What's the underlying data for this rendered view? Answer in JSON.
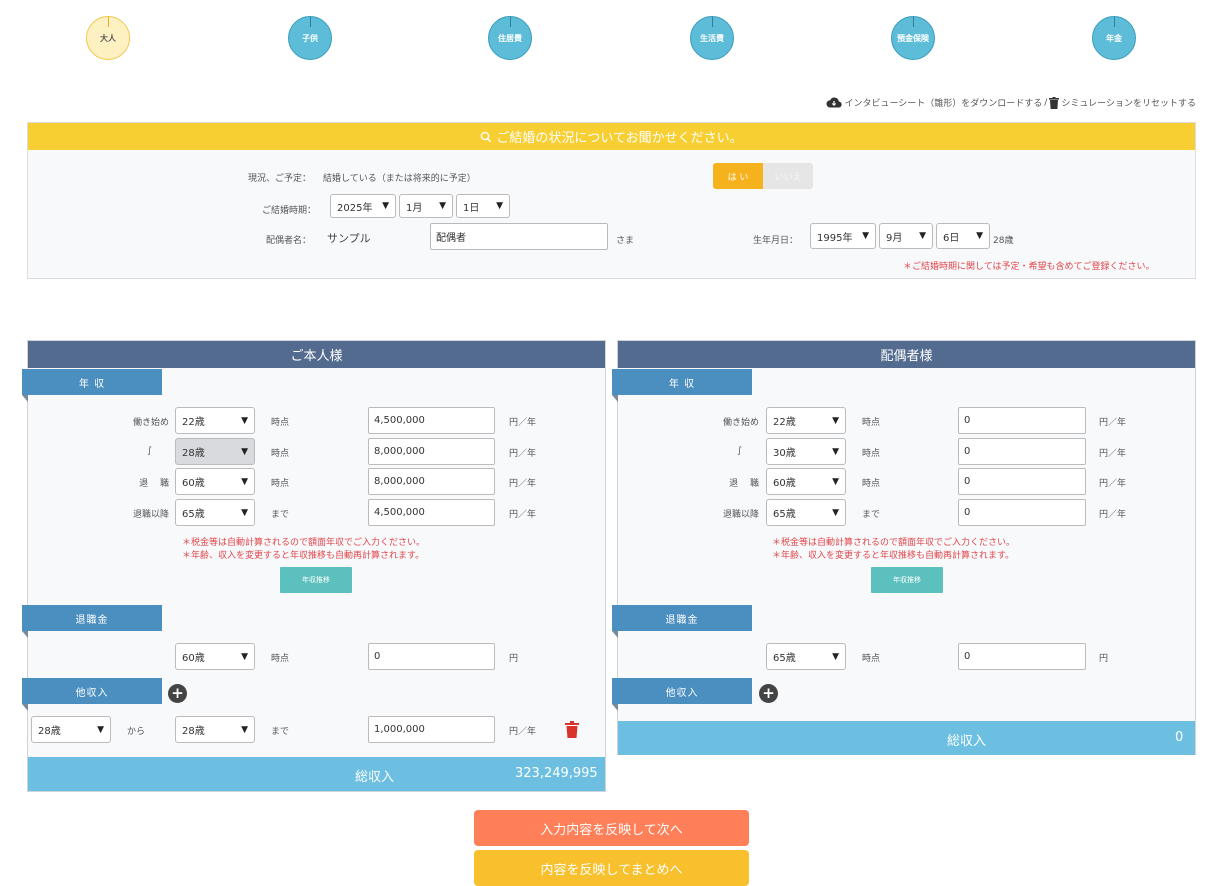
{
  "steps": [
    "大人",
    "子供",
    "住居費",
    "生活費",
    "預金保険",
    "年金"
  ],
  "toplinks": {
    "download": "インタビューシート（雛形）をダウンロードする",
    "separator": "/",
    "reset": "シミュレーションをリセットする"
  },
  "marriage": {
    "header": "ご結婚の状況についてお聞かせください。",
    "status_label": "現況、ご予定：",
    "status_text": "結婚している（または将来的に予定）",
    "yes": "は い",
    "no": "いいえ",
    "date_label": "ご結婚時期：",
    "year": "2025年",
    "month": "1月",
    "day": "1日",
    "spouse_label": "配偶者名：",
    "spouse_last": "サンプル",
    "spouse_first": "配偶者",
    "sama": "さま",
    "birth_label": "生年月日：",
    "birth_year": "1995年",
    "birth_month": "9月",
    "birth_day": "6日",
    "age": "28歳",
    "note": "＊ご結婚時期に関しては予定・希望も含めてご登録ください。"
  },
  "self": {
    "title": "ご本人様",
    "section_income": "年 収",
    "rows": [
      {
        "label": "働き始め",
        "age": "22歳",
        "suffix": "時点",
        "amount": "4,500,000",
        "unit": "円／年"
      },
      {
        "label": "∫",
        "age": "28歳",
        "suffix": "時点",
        "amount": "8,000,000",
        "unit": "円／年"
      },
      {
        "label": "退　 職",
        "age": "60歳",
        "suffix": "時点",
        "amount": "8,000,000",
        "unit": "円／年"
      },
      {
        "label": "退職以降",
        "age": "65歳",
        "suffix": "まで",
        "amount": "4,500,000",
        "unit": "円／年"
      }
    ],
    "note1": "＊税金等は自動計算されるので額面年収でご入力ください。",
    "note2": "＊年齢、収入を変更すると年収推移も自動再計算されます。",
    "trend_button": "年収推移",
    "section_retire": "退職金",
    "retire_age": "60歳",
    "retire_suffix": "時点",
    "retire_amount": "0",
    "retire_unit": "円",
    "section_other": "他収入",
    "other": {
      "from_age": "28歳",
      "from_label": "から",
      "to_age": "28歳",
      "to_label": "まで",
      "amount": "1,000,000",
      "unit": "円／年"
    },
    "total_label": "総収入",
    "total_value": "323,249,995"
  },
  "spouse": {
    "title": "配偶者様",
    "section_income": "年 収",
    "rows": [
      {
        "label": "働き始め",
        "age": "22歳",
        "suffix": "時点",
        "amount": "0",
        "unit": "円／年"
      },
      {
        "label": "∫",
        "age": "30歳",
        "suffix": "時点",
        "amount": "0",
        "unit": "円／年"
      },
      {
        "label": "退　 職",
        "age": "60歳",
        "suffix": "時点",
        "amount": "0",
        "unit": "円／年"
      },
      {
        "label": "退職以降",
        "age": "65歳",
        "suffix": "まで",
        "amount": "0",
        "unit": "円／年"
      }
    ],
    "note1": "＊税金等は自動計算されるので額面年収でご入力ください。",
    "note2": "＊年齢、収入を変更すると年収推移も自動再計算されます。",
    "trend_button": "年収推移",
    "section_retire": "退職金",
    "retire_age": "65歳",
    "retire_suffix": "時点",
    "retire_amount": "0",
    "retire_unit": "円",
    "section_other": "他収入",
    "total_label": "総収入",
    "total_value": "0"
  },
  "buttons": {
    "next": "入力内容を反映して次へ",
    "summary": "内容を反映してまとめへ"
  },
  "colors": {
    "accent_yellow": "#f8cf32",
    "panel_header": "#536b8f",
    "section_blue": "#4b8ec0",
    "total_blue": "#6dbfe1",
    "next_orange": "#ff7f58",
    "summary_yellow": "#f8c02c"
  }
}
